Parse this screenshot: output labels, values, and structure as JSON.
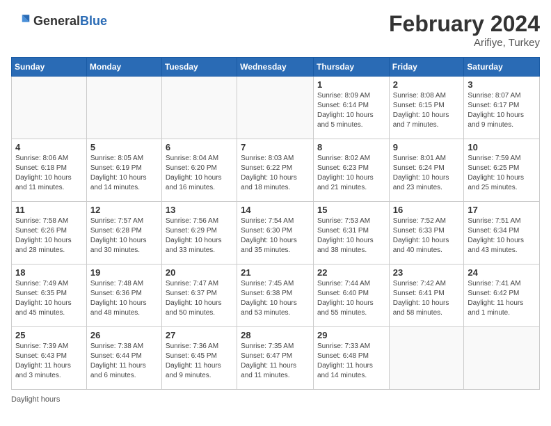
{
  "header": {
    "logo": {
      "general": "General",
      "blue": "Blue"
    },
    "title": "February 2024",
    "location": "Arifiye, Turkey"
  },
  "weekdays": [
    "Sunday",
    "Monday",
    "Tuesday",
    "Wednesday",
    "Thursday",
    "Friday",
    "Saturday"
  ],
  "weeks": [
    [
      {
        "day": "",
        "sunrise": "",
        "sunset": "",
        "daylight": ""
      },
      {
        "day": "",
        "sunrise": "",
        "sunset": "",
        "daylight": ""
      },
      {
        "day": "",
        "sunrise": "",
        "sunset": "",
        "daylight": ""
      },
      {
        "day": "",
        "sunrise": "",
        "sunset": "",
        "daylight": ""
      },
      {
        "day": "1",
        "sunrise": "Sunrise: 8:09 AM",
        "sunset": "Sunset: 6:14 PM",
        "daylight": "Daylight: 10 hours and 5 minutes."
      },
      {
        "day": "2",
        "sunrise": "Sunrise: 8:08 AM",
        "sunset": "Sunset: 6:15 PM",
        "daylight": "Daylight: 10 hours and 7 minutes."
      },
      {
        "day": "3",
        "sunrise": "Sunrise: 8:07 AM",
        "sunset": "Sunset: 6:17 PM",
        "daylight": "Daylight: 10 hours and 9 minutes."
      }
    ],
    [
      {
        "day": "4",
        "sunrise": "Sunrise: 8:06 AM",
        "sunset": "Sunset: 6:18 PM",
        "daylight": "Daylight: 10 hours and 11 minutes."
      },
      {
        "day": "5",
        "sunrise": "Sunrise: 8:05 AM",
        "sunset": "Sunset: 6:19 PM",
        "daylight": "Daylight: 10 hours and 14 minutes."
      },
      {
        "day": "6",
        "sunrise": "Sunrise: 8:04 AM",
        "sunset": "Sunset: 6:20 PM",
        "daylight": "Daylight: 10 hours and 16 minutes."
      },
      {
        "day": "7",
        "sunrise": "Sunrise: 8:03 AM",
        "sunset": "Sunset: 6:22 PM",
        "daylight": "Daylight: 10 hours and 18 minutes."
      },
      {
        "day": "8",
        "sunrise": "Sunrise: 8:02 AM",
        "sunset": "Sunset: 6:23 PM",
        "daylight": "Daylight: 10 hours and 21 minutes."
      },
      {
        "day": "9",
        "sunrise": "Sunrise: 8:01 AM",
        "sunset": "Sunset: 6:24 PM",
        "daylight": "Daylight: 10 hours and 23 minutes."
      },
      {
        "day": "10",
        "sunrise": "Sunrise: 7:59 AM",
        "sunset": "Sunset: 6:25 PM",
        "daylight": "Daylight: 10 hours and 25 minutes."
      }
    ],
    [
      {
        "day": "11",
        "sunrise": "Sunrise: 7:58 AM",
        "sunset": "Sunset: 6:26 PM",
        "daylight": "Daylight: 10 hours and 28 minutes."
      },
      {
        "day": "12",
        "sunrise": "Sunrise: 7:57 AM",
        "sunset": "Sunset: 6:28 PM",
        "daylight": "Daylight: 10 hours and 30 minutes."
      },
      {
        "day": "13",
        "sunrise": "Sunrise: 7:56 AM",
        "sunset": "Sunset: 6:29 PM",
        "daylight": "Daylight: 10 hours and 33 minutes."
      },
      {
        "day": "14",
        "sunrise": "Sunrise: 7:54 AM",
        "sunset": "Sunset: 6:30 PM",
        "daylight": "Daylight: 10 hours and 35 minutes."
      },
      {
        "day": "15",
        "sunrise": "Sunrise: 7:53 AM",
        "sunset": "Sunset: 6:31 PM",
        "daylight": "Daylight: 10 hours and 38 minutes."
      },
      {
        "day": "16",
        "sunrise": "Sunrise: 7:52 AM",
        "sunset": "Sunset: 6:33 PM",
        "daylight": "Daylight: 10 hours and 40 minutes."
      },
      {
        "day": "17",
        "sunrise": "Sunrise: 7:51 AM",
        "sunset": "Sunset: 6:34 PM",
        "daylight": "Daylight: 10 hours and 43 minutes."
      }
    ],
    [
      {
        "day": "18",
        "sunrise": "Sunrise: 7:49 AM",
        "sunset": "Sunset: 6:35 PM",
        "daylight": "Daylight: 10 hours and 45 minutes."
      },
      {
        "day": "19",
        "sunrise": "Sunrise: 7:48 AM",
        "sunset": "Sunset: 6:36 PM",
        "daylight": "Daylight: 10 hours and 48 minutes."
      },
      {
        "day": "20",
        "sunrise": "Sunrise: 7:47 AM",
        "sunset": "Sunset: 6:37 PM",
        "daylight": "Daylight: 10 hours and 50 minutes."
      },
      {
        "day": "21",
        "sunrise": "Sunrise: 7:45 AM",
        "sunset": "Sunset: 6:38 PM",
        "daylight": "Daylight: 10 hours and 53 minutes."
      },
      {
        "day": "22",
        "sunrise": "Sunrise: 7:44 AM",
        "sunset": "Sunset: 6:40 PM",
        "daylight": "Daylight: 10 hours and 55 minutes."
      },
      {
        "day": "23",
        "sunrise": "Sunrise: 7:42 AM",
        "sunset": "Sunset: 6:41 PM",
        "daylight": "Daylight: 10 hours and 58 minutes."
      },
      {
        "day": "24",
        "sunrise": "Sunrise: 7:41 AM",
        "sunset": "Sunset: 6:42 PM",
        "daylight": "Daylight: 11 hours and 1 minute."
      }
    ],
    [
      {
        "day": "25",
        "sunrise": "Sunrise: 7:39 AM",
        "sunset": "Sunset: 6:43 PM",
        "daylight": "Daylight: 11 hours and 3 minutes."
      },
      {
        "day": "26",
        "sunrise": "Sunrise: 7:38 AM",
        "sunset": "Sunset: 6:44 PM",
        "daylight": "Daylight: 11 hours and 6 minutes."
      },
      {
        "day": "27",
        "sunrise": "Sunrise: 7:36 AM",
        "sunset": "Sunset: 6:45 PM",
        "daylight": "Daylight: 11 hours and 9 minutes."
      },
      {
        "day": "28",
        "sunrise": "Sunrise: 7:35 AM",
        "sunset": "Sunset: 6:47 PM",
        "daylight": "Daylight: 11 hours and 11 minutes."
      },
      {
        "day": "29",
        "sunrise": "Sunrise: 7:33 AM",
        "sunset": "Sunset: 6:48 PM",
        "daylight": "Daylight: 11 hours and 14 minutes."
      },
      {
        "day": "",
        "sunrise": "",
        "sunset": "",
        "daylight": ""
      },
      {
        "day": "",
        "sunrise": "",
        "sunset": "",
        "daylight": ""
      }
    ]
  ],
  "footer": {
    "daylight_label": "Daylight hours"
  }
}
